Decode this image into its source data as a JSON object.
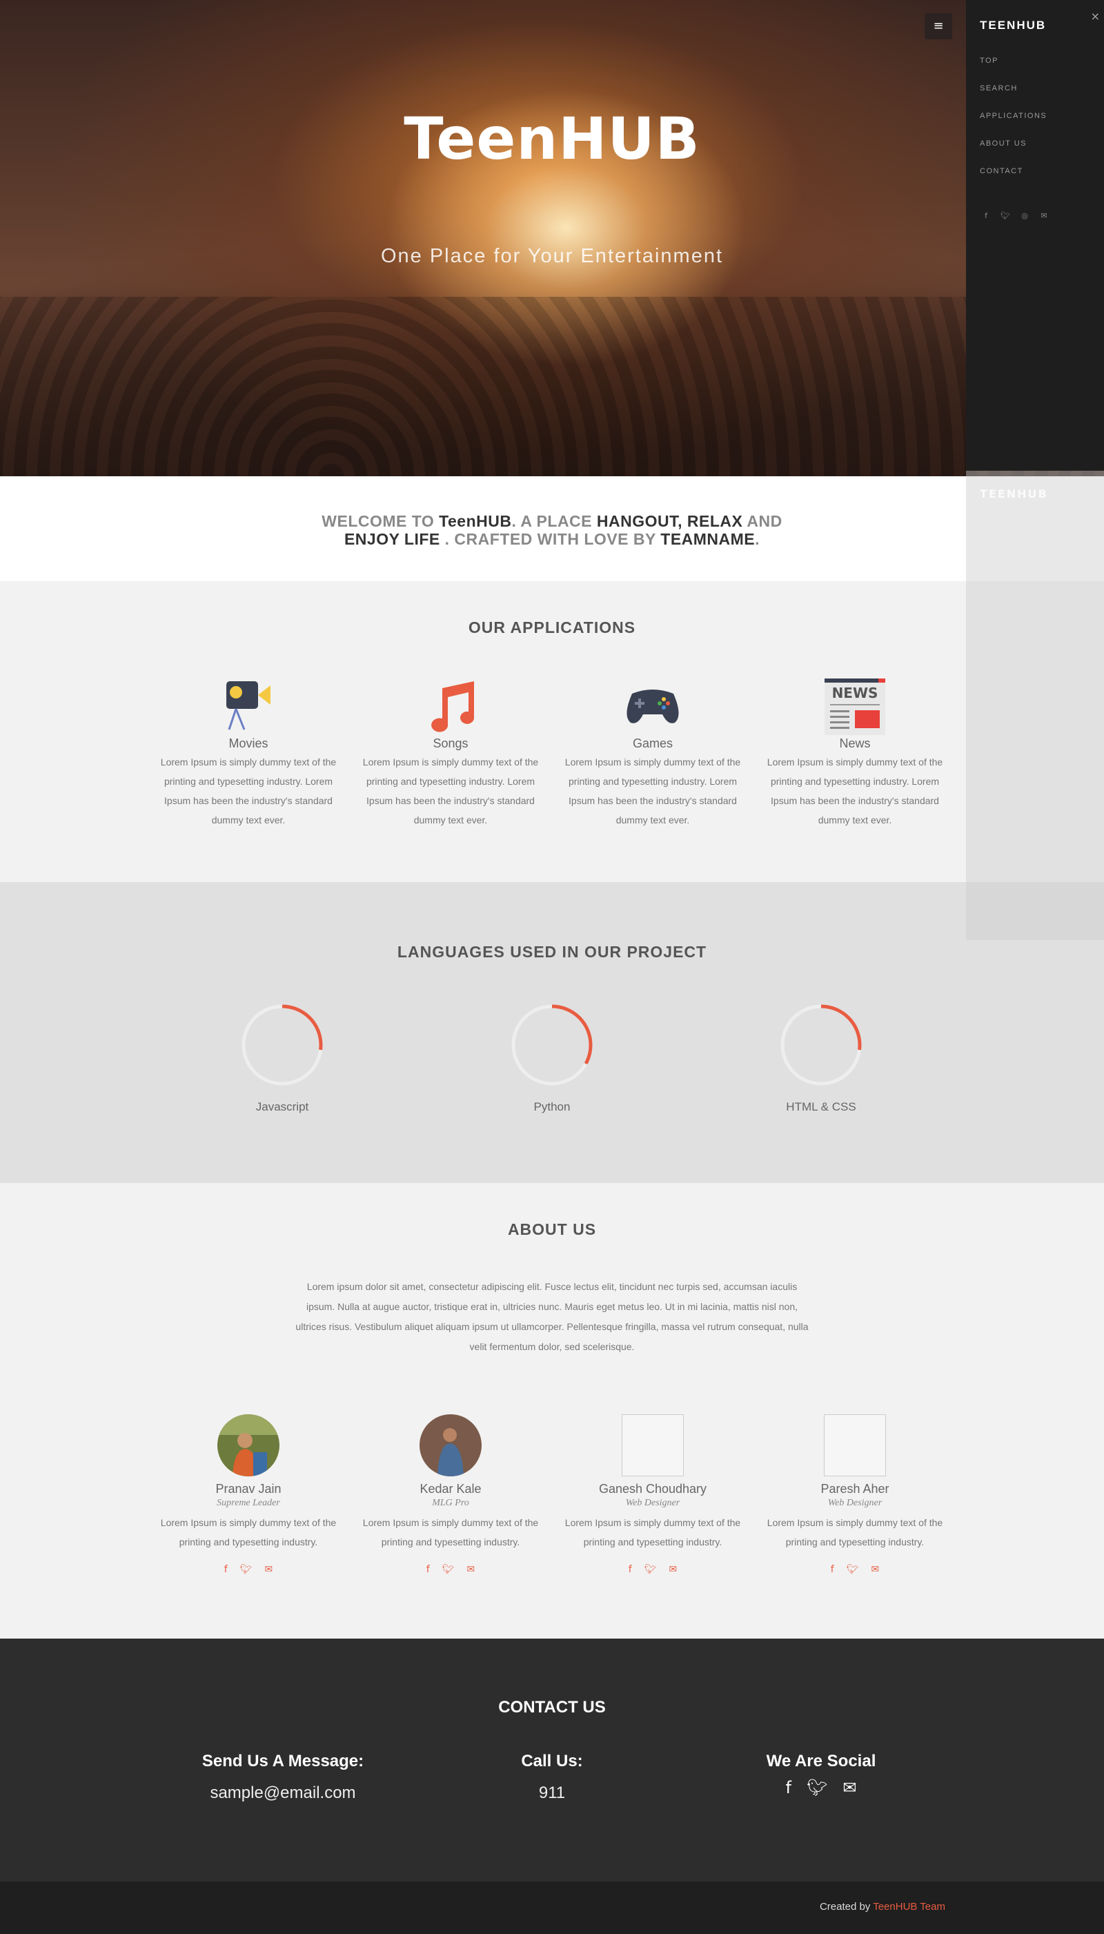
{
  "hero": {
    "title": "TeenHUB",
    "subtitle": "One Place for Your Entertainment"
  },
  "nav": {
    "toggle_icon": "hamburger-icon",
    "brand": "TEENHUB",
    "close": "×",
    "items": [
      "TOP",
      "SEARCH",
      "APPLICATIONS",
      "ABOUT US",
      "CONTACT"
    ],
    "social_icons": [
      "facebook-icon",
      "twitter-icon",
      "dribbble-icon",
      "envelope-icon"
    ]
  },
  "welcome": {
    "part1": "WELCOME TO ",
    "brand": "TeenHUB",
    "part2": ". A PLACE ",
    "hl1": "HANGOUT, RELAX",
    "part3": " AND ",
    "hl2": "ENJOY LIFE",
    "part4": " . CRAFTED WITH LOVE BY ",
    "hl3": "TEAMNAME",
    "part5": "."
  },
  "applications": {
    "title": "OUR APPLICATIONS",
    "items": [
      {
        "name": "Movies",
        "icon": "movie-camera-icon",
        "desc": "Lorem Ipsum is simply dummy text of the printing and typesetting industry. Lorem Ipsum has been the industry's standard dummy text ever."
      },
      {
        "name": "Songs",
        "icon": "music-note-icon",
        "desc": "Lorem Ipsum is simply dummy text of the printing and typesetting industry. Lorem Ipsum has been the industry's standard dummy text ever."
      },
      {
        "name": "Games",
        "icon": "gamepad-icon",
        "desc": "Lorem Ipsum is simply dummy text of the printing and typesetting industry. Lorem Ipsum has been the industry's standard dummy text ever."
      },
      {
        "name": "News",
        "icon": "newspaper-icon",
        "icon_label": "NEWS",
        "desc": "Lorem Ipsum is simply dummy text of the printing and typesetting industry. Lorem Ipsum has been the industry's standard dummy text ever."
      }
    ]
  },
  "languages": {
    "title": "LANGUAGES USED IN OUR PROJECT",
    "items": [
      {
        "name": "Javascript",
        "progress": 0.27
      },
      {
        "name": "Python",
        "progress": 0.33
      },
      {
        "name": "HTML & CSS",
        "progress": 0.27
      }
    ],
    "accent_color": "#e85c41"
  },
  "about": {
    "title": "ABOUT US",
    "text": "Lorem ipsum dolor sit amet, consectetur adipiscing elit. Fusce lectus elit, tincidunt nec turpis sed, accumsan iaculis ipsum. Nulla at augue auctor, tristique erat in, ultricies nunc. Mauris eget metus leo. Ut in mi lacinia, mattis nisl non, ultrices risus. Vestibulum aliquet aliquam ipsum ut ullamcorper. Pellentesque fringilla, massa vel rutrum consequat, nulla velit fermentum dolor, sed scelerisque.",
    "team": [
      {
        "name": "Pranav Jain",
        "role": "Supreme Leader",
        "desc": "Lorem Ipsum is simply dummy text of the printing and typesetting industry."
      },
      {
        "name": "Kedar Kale",
        "role": "MLG Pro",
        "desc": "Lorem Ipsum is simply dummy text of the printing and typesetting industry."
      },
      {
        "name": "Ganesh Choudhary",
        "role": "Web Designer",
        "desc": "Lorem Ipsum is simply dummy text of the printing and typesetting industry."
      },
      {
        "name": "Paresh Aher",
        "role": "Web Designer",
        "desc": "Lorem Ipsum is simply dummy text of the printing and typesetting industry."
      }
    ],
    "member_social_icons": [
      "facebook-icon",
      "twitter-icon",
      "envelope-icon"
    ]
  },
  "contact": {
    "title": "CONTACT US",
    "message_heading": "Send Us A Message:",
    "email": "sample@email.com",
    "call_heading": "Call Us:",
    "phone": "911",
    "social_heading": "We Are Social",
    "social_icons": [
      "facebook-icon",
      "twitter-icon",
      "envelope-icon"
    ]
  },
  "footer": {
    "created_by": "Created by ",
    "team": "TeenHUB Team"
  },
  "colors": {
    "accent": "#e85c41",
    "dark": "#2d2d2d",
    "sidebar": "#1e1e1e"
  }
}
